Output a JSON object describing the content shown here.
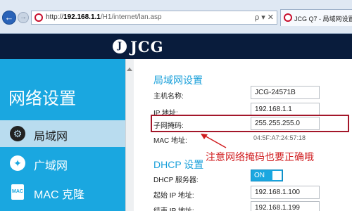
{
  "browser": {
    "back_glyph": "←",
    "forward_glyph": "→",
    "url_scheme": "http://",
    "url_host": "192.168.1.1",
    "url_path": "/H1/internet/lan.asp",
    "address_tools": "ρ ▾ ✕",
    "tab_title": "JCG Q7 - 局域网设置"
  },
  "header": {
    "logo_symbol": "J",
    "logo_text": "JCG",
    "background": "#091c3c"
  },
  "sidebar": {
    "title": "网络设置",
    "accent": "#1aa7e0",
    "items": [
      {
        "label": "局域网",
        "icon": "gear-icon",
        "glyph": "⚙"
      },
      {
        "label": "广域网",
        "icon": "globe-icon",
        "glyph": "✦"
      },
      {
        "label": "MAC 克隆",
        "icon": "mac-card-icon",
        "glyph": "MAC"
      }
    ]
  },
  "lan": {
    "title": "局域网设置",
    "hostname_label": "主机名称:",
    "hostname_value": "JCG-24571B",
    "ip_label": "IP 地址:",
    "ip_value": "192.168.1.1",
    "netmask_label": "子网掩码:",
    "netmask_value": "255.255.255.0",
    "mac_label": "MAC 地址:",
    "mac_value": "04:5F:A7:24:57:18"
  },
  "annotation": {
    "text": "注意网络掩码也要正确哦",
    "color": "#d01c1f"
  },
  "dhcp": {
    "title": "DHCP 设置",
    "server_label": "DHCP 服务器:",
    "server_toggle": "ON",
    "start_label": "起始 IP 地址:",
    "start_value": "192.168.1.100",
    "end_label": "结束 IP 地址:",
    "end_value": "192.168.1.199"
  }
}
